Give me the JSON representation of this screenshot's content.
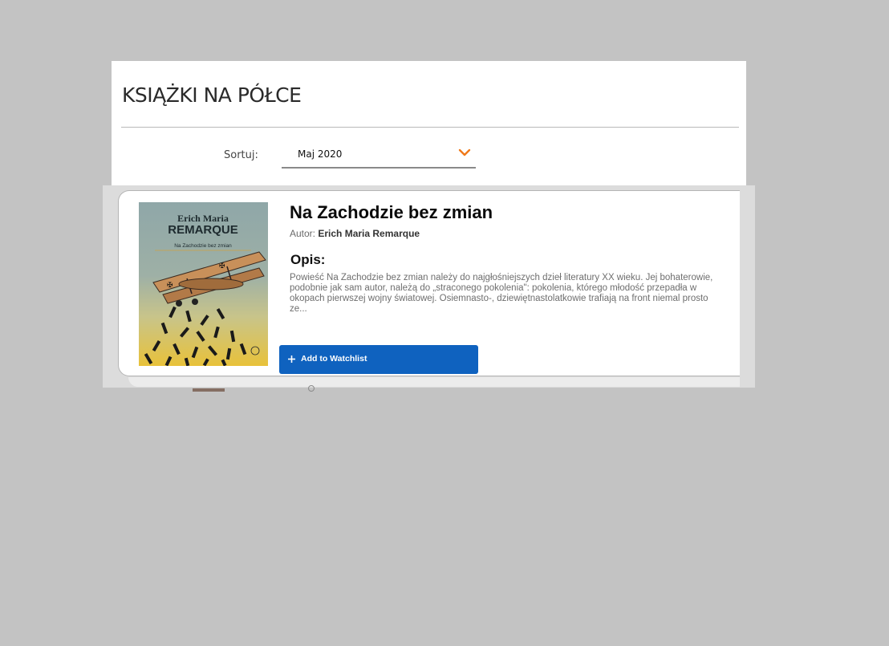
{
  "page": {
    "title": "KSIĄŻKI NA PÓŁCE"
  },
  "sort": {
    "label": "Sortuj:",
    "selected": "Maj 2020"
  },
  "book": {
    "title": "Na Zachodzie bez zmian",
    "author_label": "Autor:",
    "author": "Erich Maria Remarque",
    "description_heading": "Opis:",
    "description": "Powieść Na Zachodzie bez zmian należy do najgłośniejszych dzieł literatury XX wieku. Jej bohaterowie, podobnie jak sam autor, należą do „straconego pokolenia\": pokolenia, którego młodość przepadła w okopach pierwszej wojny światowej. Osiemnasto-, dziewiętnastolatkowie trafiają na front niemal prosto ze...",
    "cover": {
      "author_first": "Erich Maria",
      "author_last": "REMARQUE",
      "title": "Na Zachodzie bez zmian"
    }
  },
  "actions": {
    "watchlist_label": "Add to Watchlist"
  },
  "colors": {
    "accent_orange": "#f07a1a",
    "button_blue": "#0f62bf",
    "background": "#c3c3c3"
  },
  "icons": {
    "sort_chevron": "chevron-down-icon",
    "watchlist": "plus-icon"
  }
}
